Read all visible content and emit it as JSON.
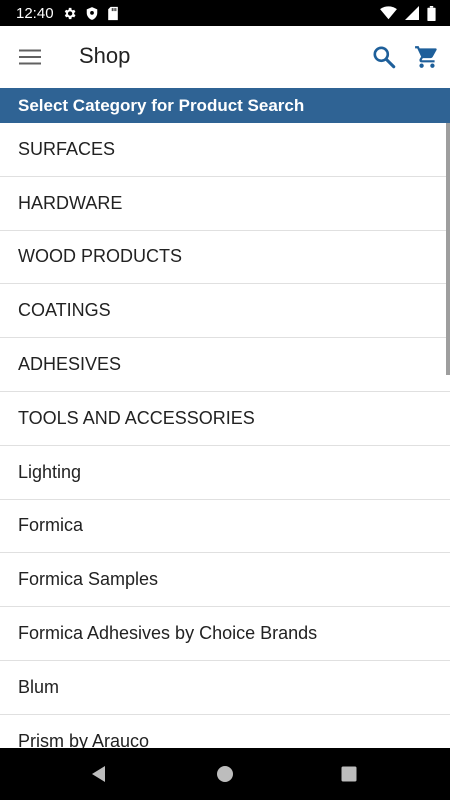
{
  "status_bar": {
    "time": "12:40",
    "icons_left": [
      "gear-icon",
      "shield-icon",
      "sd-card-icon"
    ],
    "icons_right": [
      "wifi-icon",
      "signal-icon",
      "battery-icon"
    ]
  },
  "app_bar": {
    "title": "Shop",
    "icons": [
      "menu-icon",
      "search-icon",
      "cart-icon"
    ],
    "accent_color": "#1e5f9a"
  },
  "section_header": {
    "label": "Select Category for Product Search",
    "background_color": "#2f6394"
  },
  "categories": [
    "SURFACES",
    "HARDWARE",
    "WOOD PRODUCTS",
    "COATINGS",
    "ADHESIVES",
    "TOOLS AND ACCESSORIES",
    "Lighting",
    "Formica",
    "Formica Samples",
    "Formica Adhesives by Choice Brands",
    "Blum",
    "Prism by Arauco"
  ],
  "nav_bar": {
    "icons": [
      "back-icon",
      "home-icon",
      "recents-icon"
    ]
  }
}
